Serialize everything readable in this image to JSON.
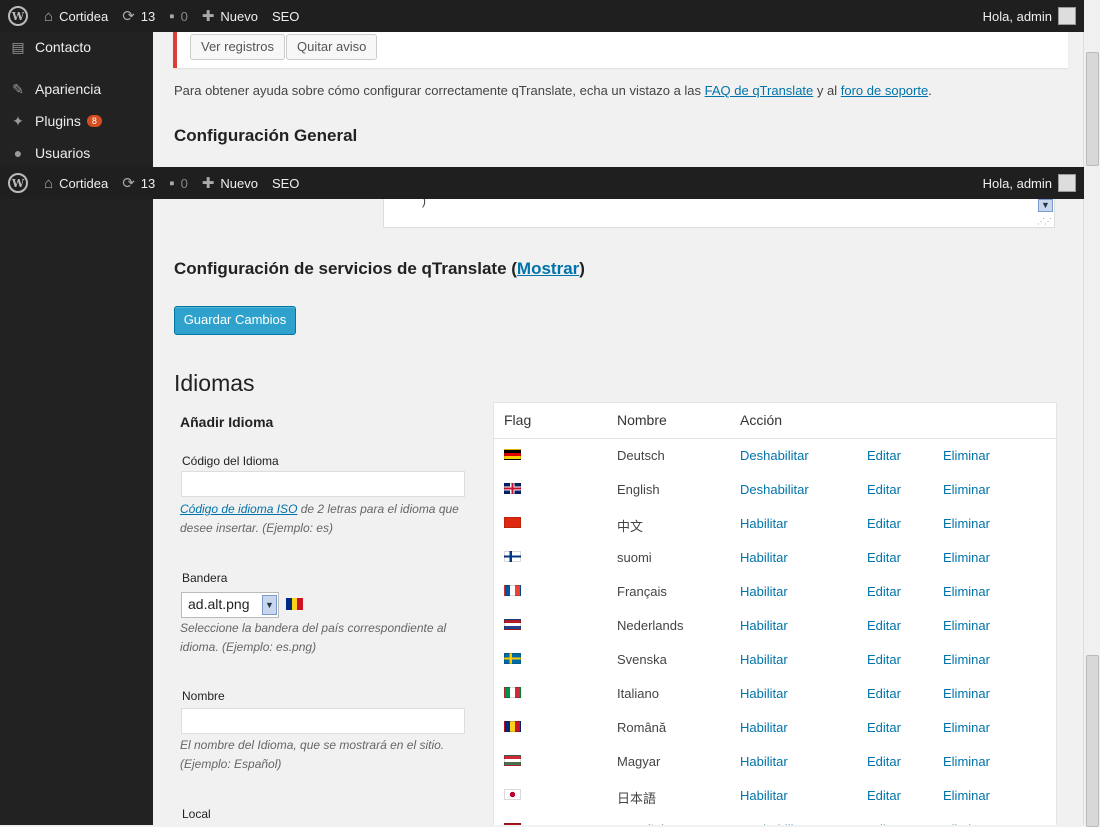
{
  "adminbar": {
    "site_name": "Cortidea",
    "updates": "13",
    "comments": "0",
    "new_label": "Nuevo",
    "seo_label": "SEO",
    "greeting": "Hola, admin"
  },
  "sidebar_top": [
    {
      "label": "Contacto",
      "icon": "contact-icon"
    },
    {
      "label": "Apariencia",
      "icon": "appearance-icon"
    },
    {
      "label": "Plugins",
      "icon": "plugins-icon",
      "badge": "8"
    },
    {
      "label": "Usuarios",
      "icon": "users-icon"
    }
  ],
  "notice": {
    "view_log": "Ver registros",
    "remove_notice": "Quitar aviso"
  },
  "help": {
    "prefix": "Para obtener ayuda sobre cómo configurar correctamente qTranslate, echa un vistazo a las ",
    "faq_link": "FAQ de qTranslate",
    "middle": " y al ",
    "forum_link": "foro de soporte",
    "suffix": "."
  },
  "general_heading": "Configuración General",
  "textarea_tail": ")",
  "services": {
    "heading_prefix": "Configuración de servicios de qTranslate (",
    "show_link": "Mostrar",
    "heading_suffix": ")"
  },
  "save_button": "Guardar Cambios",
  "languages_heading": "Idiomas",
  "form": {
    "title": "Añadir Idioma",
    "code_label": "Código del Idioma",
    "code_desc_link": "Código de idioma ISO",
    "code_desc": " de 2 letras para el idioma que desee insertar. (Ejemplo: es)",
    "flag_label": "Bandera",
    "flag_value": "ad.alt.png",
    "flag_desc": "Seleccione la bandera del país correspondiente al idioma. (Ejemplo: es.png)",
    "name_label": "Nombre",
    "name_desc": "El nombre del Idioma, que se mostrará en el sitio. (Ejemplo: Español)",
    "locale_label": "Local"
  },
  "table": {
    "headers": {
      "flag": "Flag",
      "name": "Nombre",
      "action": "Acción"
    },
    "edit_label": "Editar",
    "delete_label": "Eliminar",
    "rows": [
      {
        "name": "Deutsch",
        "action": "Deshabilitar",
        "flag": [
          "#000000",
          "#dd0000",
          "#ffce00"
        ],
        "dir": "h"
      },
      {
        "name": "English",
        "action": "Deshabilitar",
        "flag": [
          "#012169",
          "#ffffff",
          "#c8102e"
        ],
        "dir": "uk"
      },
      {
        "name": "中文",
        "action": "Habilitar",
        "flag": [
          "#de2910",
          "#de2910",
          "#de2910"
        ],
        "dir": "h"
      },
      {
        "name": "suomi",
        "action": "Habilitar",
        "flag": [
          "#ffffff",
          "#003580",
          "#ffffff"
        ],
        "dir": "nordic"
      },
      {
        "name": "Français",
        "action": "Habilitar",
        "flag": [
          "#0055a4",
          "#ffffff",
          "#ef4135"
        ],
        "dir": "v"
      },
      {
        "name": "Nederlands",
        "action": "Habilitar",
        "flag": [
          "#ae1c28",
          "#ffffff",
          "#21468b"
        ],
        "dir": "h"
      },
      {
        "name": "Svenska",
        "action": "Habilitar",
        "flag": [
          "#006aa7",
          "#fecc00",
          "#006aa7"
        ],
        "dir": "nordic"
      },
      {
        "name": "Italiano",
        "action": "Habilitar",
        "flag": [
          "#009246",
          "#ffffff",
          "#ce2b37"
        ],
        "dir": "v"
      },
      {
        "name": "Română",
        "action": "Habilitar",
        "flag": [
          "#002b7f",
          "#fcd116",
          "#ce1126"
        ],
        "dir": "v"
      },
      {
        "name": "Magyar",
        "action": "Habilitar",
        "flag": [
          "#ce2939",
          "#ffffff",
          "#477050"
        ],
        "dir": "h"
      },
      {
        "name": "日本語",
        "action": "Habilitar",
        "flag": [
          "#ffffff",
          "#bc002d",
          "#ffffff"
        ],
        "dir": "jp"
      },
      {
        "name": "Español",
        "action": "Deshabilitar",
        "flag": [
          "#aa151b",
          "#f1bf00",
          "#aa151b"
        ],
        "dir": "h"
      }
    ]
  }
}
